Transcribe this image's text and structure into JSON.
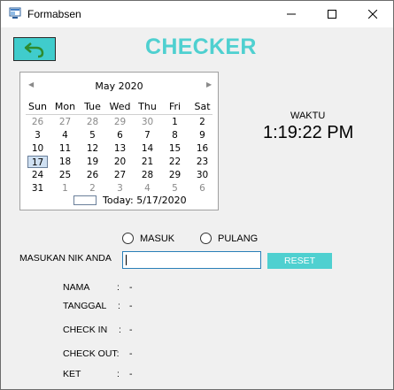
{
  "window": {
    "title": "Formabsen"
  },
  "header": {
    "title": "CHECKER"
  },
  "calendar": {
    "month_label": "May 2020",
    "weekdays": [
      "Sun",
      "Mon",
      "Tue",
      "Wed",
      "Thu",
      "Fri",
      "Sat"
    ],
    "weeks": [
      [
        "26",
        "27",
        "28",
        "29",
        "30",
        "1",
        "2"
      ],
      [
        "3",
        "4",
        "5",
        "6",
        "7",
        "8",
        "9"
      ],
      [
        "10",
        "11",
        "12",
        "13",
        "14",
        "15",
        "16"
      ],
      [
        "17",
        "18",
        "19",
        "20",
        "21",
        "22",
        "23"
      ],
      [
        "24",
        "25",
        "26",
        "27",
        "28",
        "29",
        "30"
      ],
      [
        "31",
        "1",
        "2",
        "3",
        "4",
        "5",
        "6"
      ]
    ],
    "selected_day": "17",
    "today_label": "Today: 5/17/2020"
  },
  "clock": {
    "label": "WAKTU",
    "time": "1:19:22 PM"
  },
  "mode": {
    "options": [
      "MASUK",
      "PULANG"
    ],
    "selected": null
  },
  "nik": {
    "label": "MASUKAN NIK ANDA",
    "value": ""
  },
  "reset_label": "RESET",
  "info": [
    {
      "label": "NAMA",
      "colon": ":",
      "value": "-"
    },
    {
      "label": "TANGGAL",
      "colon": ":",
      "value": "-"
    },
    {
      "label": "CHECK IN",
      "colon": ":",
      "value": "-"
    },
    {
      "label": "CHECK OUT:",
      "colon": "",
      "value": "-"
    },
    {
      "label": "KET",
      "colon": ":",
      "value": "-"
    }
  ],
  "colors": {
    "accent": "#4fd0d0",
    "back_button": "#40cccc",
    "back_arrow": "#2e8b2e"
  }
}
